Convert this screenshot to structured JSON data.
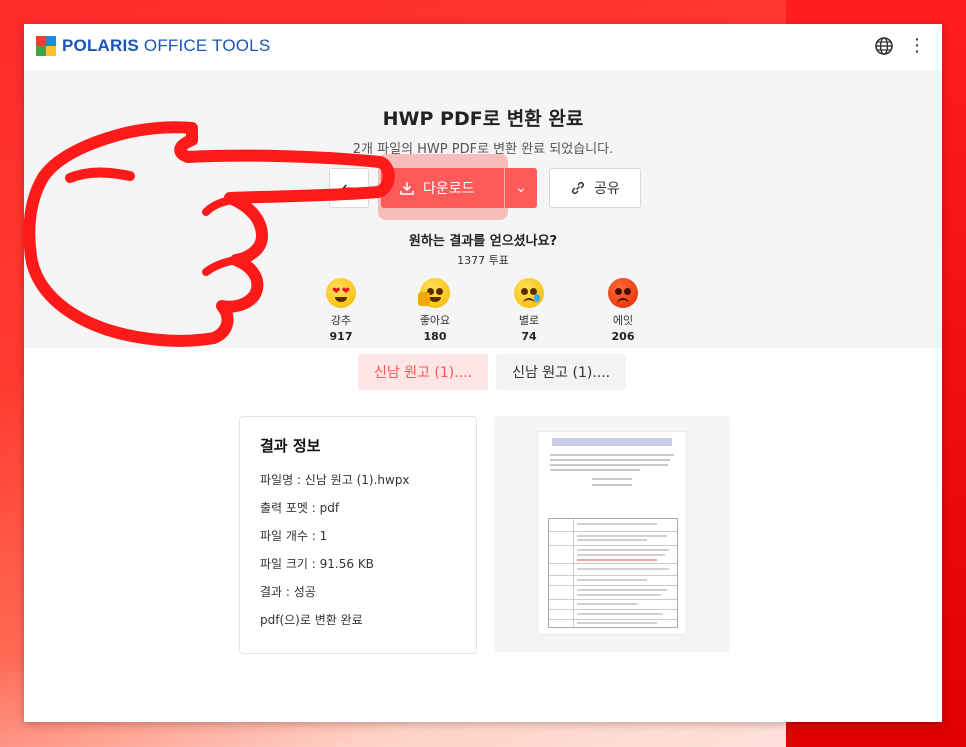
{
  "app": {
    "brand_bold": "POLARIS",
    "brand_light": " OFFICE TOOLS"
  },
  "header": {
    "globe_icon": "globe-icon",
    "menu_icon": "kebab-menu-icon"
  },
  "hero": {
    "title": "HWP PDF로 변환 완료",
    "subtitle": "2개 파일의 HWP PDF로 변환 완료 되었습니다.",
    "back_label": "←",
    "download_label": "다운로드",
    "share_label": "공유",
    "question": "원하는 결과를 얻으셨나요?",
    "votes": "1377 투표",
    "reactions": [
      {
        "label": "강추",
        "count": "917",
        "icon": "heart-eyes-emoji-icon"
      },
      {
        "label": "좋아요",
        "count": "180",
        "icon": "thumbs-up-emoji-icon"
      },
      {
        "label": "별로",
        "count": "74",
        "icon": "sad-emoji-icon"
      },
      {
        "label": "에잇",
        "count": "206",
        "icon": "angry-emoji-icon"
      }
    ]
  },
  "tabs": [
    {
      "label": "신남 원고 (1)....",
      "active": true
    },
    {
      "label": "신남 원고 (1)....",
      "active": false
    }
  ],
  "info": {
    "title": "결과 정보",
    "filename": "파일명 : 신남 원고 (1).hwpx",
    "format": "출력 포멧 : pdf",
    "count": "파일 개수 : 1",
    "size": "파일 크기 : 91.56 KB",
    "result": "결과 : 성공",
    "message": "pdf(으)로 변환 완료"
  },
  "colors": {
    "accent": "#ff5a5a",
    "brand": "#1a56b7"
  }
}
